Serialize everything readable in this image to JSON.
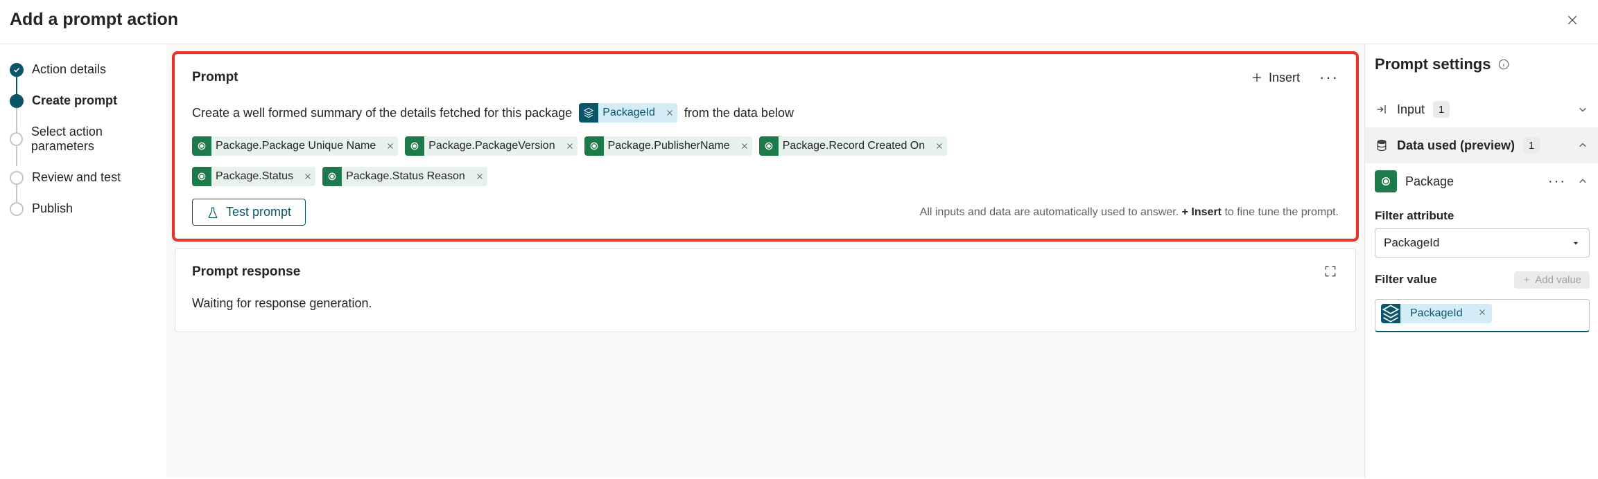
{
  "header": {
    "title": "Add a prompt action"
  },
  "steps": [
    {
      "label": "Action details",
      "state": "completed"
    },
    {
      "label": "Create prompt",
      "state": "current"
    },
    {
      "label": "Select action parameters",
      "state": "pending"
    },
    {
      "label": "Review and test",
      "state": "pending"
    },
    {
      "label": "Publish",
      "state": "pending"
    }
  ],
  "prompt": {
    "title": "Prompt",
    "insert_label": "Insert",
    "text_before": "Create a well formed summary of the details fetched for this package",
    "inline_chip": "PackageId",
    "text_after": "from the data below",
    "chips": [
      "Package.Package Unique Name",
      "Package.PackageVersion",
      "Package.PublisherName",
      "Package.Record Created On",
      "Package.Status",
      "Package.Status Reason"
    ],
    "test_button": "Test prompt",
    "hint_before": "All inputs and data are automatically used to answer. ",
    "hint_bold": "+ Insert",
    "hint_after": " to fine tune the prompt."
  },
  "response": {
    "title": "Prompt response",
    "body": "Waiting for response generation."
  },
  "settings": {
    "title": "Prompt settings",
    "input_label": "Input",
    "input_count": "1",
    "data_label": "Data used (preview)",
    "data_count": "1",
    "package_name": "Package",
    "filter_attr_label": "Filter attribute",
    "filter_attr_value": "PackageId",
    "filter_value_label": "Filter value",
    "add_value_label": "Add value",
    "filter_value_chip": "PackageId"
  }
}
